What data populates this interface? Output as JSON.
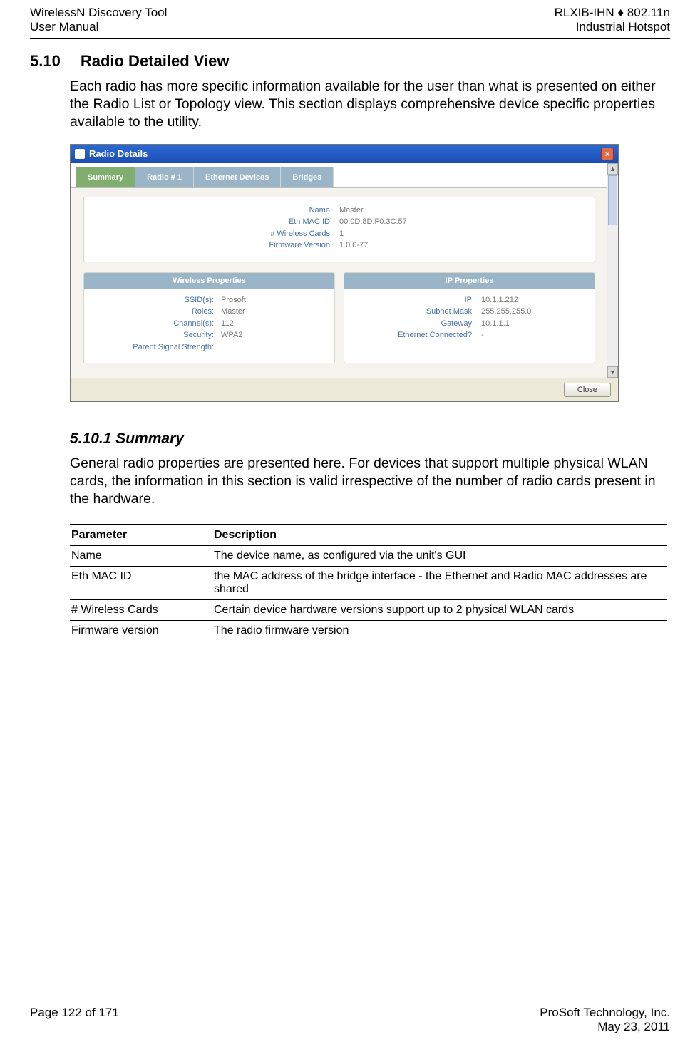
{
  "header": {
    "left1": "WirelessN Discovery Tool",
    "left2": "User Manual",
    "right1": "RLXIB-IHN ♦ 802.11n",
    "right2": "Industrial Hotspot"
  },
  "section": {
    "num": "5.10",
    "title": "Radio Detailed View",
    "intro": "Each radio has more specific information available for the user than what is presented on either the Radio List or Topology view. This section displays comprehensive device specific properties available to the utility."
  },
  "dialog": {
    "title": "Radio Details",
    "tabs": [
      "Summary",
      "Radio # 1",
      "Ethernet Devices",
      "Bridges"
    ],
    "top_labels": {
      "name": "Name:",
      "mac": "Eth MAC ID:",
      "cards": "# Wireless Cards:",
      "fw": "Firmware Version:"
    },
    "top_vals": {
      "name": "Master",
      "mac": "00:0D:8D:F0:3C:57",
      "cards": "1",
      "fw": "1.0.0-77"
    },
    "wireless": {
      "head": "Wireless Properties",
      "labels": {
        "ssid": "SSID(s):",
        "roles": "Roles:",
        "channels": "Channel(s):",
        "sec": "Security:",
        "pss": "Parent Signal Strength:"
      },
      "vals": {
        "ssid": "Prosoft",
        "roles": "Master",
        "channels": "112",
        "sec": "WPA2",
        "pss": ""
      }
    },
    "ip": {
      "head": "IP Properties",
      "labels": {
        "ip": "IP:",
        "mask": "Subnet Mask:",
        "gw": "Gateway:",
        "eth": "Ethernet Connected?:"
      },
      "vals": {
        "ip": "10.1.1.212",
        "mask": "255.255.255.0",
        "gw": "10.1.1.1",
        "eth": "-"
      }
    },
    "close": "Close"
  },
  "sub": {
    "num_title": "5.10.1 Summary",
    "text": "General radio properties are presented here. For devices that support multiple physical WLAN cards, the information in this section is valid irrespective of the number of radio cards present in the hardware."
  },
  "table": {
    "h1": "Parameter",
    "h2": "Description",
    "rows": [
      {
        "p": "Name",
        "d": "The device name, as configured via the unit's GUI"
      },
      {
        "p": "Eth MAC ID",
        "d": "the MAC address of the bridge interface - the Ethernet and Radio MAC addresses are shared"
      },
      {
        "p": "# Wireless Cards",
        "d": "Certain device hardware versions support up to 2 physical WLAN cards"
      },
      {
        "p": "Firmware version",
        "d": "The radio firmware version"
      }
    ]
  },
  "footer": {
    "left": "Page 122 of 171",
    "right1": "ProSoft Technology, Inc.",
    "right2": "May 23, 2011"
  }
}
